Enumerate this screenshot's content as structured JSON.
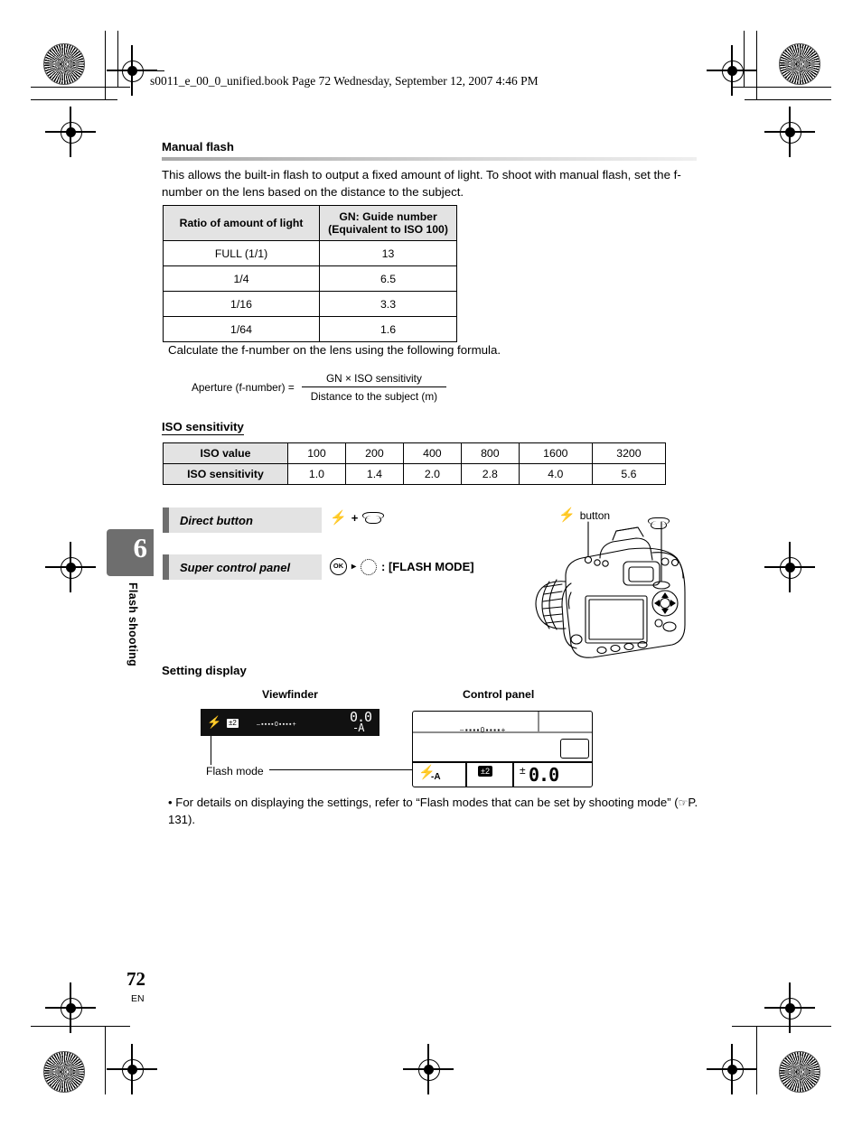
{
  "header": {
    "filename_line": "s0011_e_00_0_unified.book  Page 72  Wednesday, September 12, 2007  4:46 PM"
  },
  "chapter_tab": {
    "number": "6",
    "label": "Flash shooting"
  },
  "sections": {
    "manual_flash": {
      "heading": "Manual flash",
      "paragraph": "This allows the built-in flash to output a fixed amount of light. To shoot with manual flash, set the f-number on the lens based on the distance to the subject.",
      "table": {
        "headers": [
          "Ratio of amount of light",
          "GN: Guide number\n(Equivalent to ISO 100)"
        ],
        "header_col2_line1": "GN: Guide number",
        "header_col2_line2": "(Equivalent to ISO 100)",
        "rows": [
          [
            "FULL (1/1)",
            "13"
          ],
          [
            "1/4",
            "6.5"
          ],
          [
            "1/16",
            "3.3"
          ],
          [
            "1/64",
            "1.6"
          ]
        ]
      },
      "formula_intro": "Calculate the f-number on the lens using the following formula.",
      "formula": {
        "left": "Aperture (f-number) =",
        "numerator": "GN × ISO sensitivity",
        "denominator": "Distance to the subject (m)"
      }
    },
    "iso_sensitivity": {
      "heading": "ISO sensitivity",
      "row_label_1": "ISO value",
      "row_label_2": "ISO sensitivity",
      "iso_values": [
        "100",
        "200",
        "400",
        "800",
        "1600",
        "3200"
      ],
      "iso_factors": [
        "1.0",
        "1.4",
        "2.0",
        "2.8",
        "4.0",
        "5.6"
      ]
    },
    "controls": {
      "direct_button_label": "Direct button",
      "direct_button_value_flash_icon": "flash-bolt-icon",
      "direct_button_value_plus": "+",
      "direct_button_value_dial_icon": "control-dial-icon",
      "super_control_panel_label": "Super control panel",
      "scp_ok_icon": "OK",
      "scp_arrow": "▸",
      "scp_value_text": ": [FLASH MODE]"
    },
    "camera_callouts": {
      "flash_button_label": "button",
      "flash_button_icon": "flash-bolt-icon",
      "dial_icon": "control-dial-icon"
    },
    "setting_display": {
      "heading": "Setting display",
      "viewfinder_caption": "Viewfinder",
      "control_panel_caption": "Control panel",
      "flash_mode_label": "Flash mode",
      "viewfinder_readout": {
        "flash_icon": "flash-bolt-icon",
        "flash_comp_badge": "±2",
        "value": "0.0",
        "mode_text": "-A"
      },
      "control_panel_readout": {
        "flash_mode_icon": "flash-bolt-icon",
        "flash_mode_suffix": "-A",
        "flash_comp_badge": "±2",
        "value": "0.0"
      },
      "note": "• For details on displaying the settings, refer to “Flash modes that can be set by shooting mode” (",
      "note_page_ref": "P. 131).",
      "note_icon": "pointing-hand-icon"
    }
  },
  "footer": {
    "page_number": "72",
    "language_code": "EN"
  },
  "colors": {
    "tab_gray": "#6e6e6e",
    "table_header_gray": "#e3e3e3",
    "lcd_black": "#111111"
  }
}
